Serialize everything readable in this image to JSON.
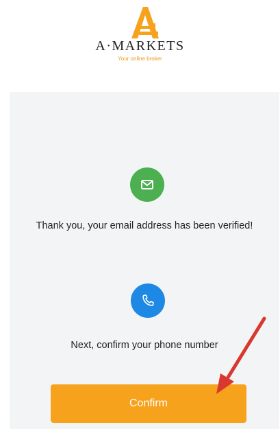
{
  "header": {
    "brand_name": "A·MARKETS",
    "tagline": "Your online broker",
    "logo_icon": "amarkets-logo-icon"
  },
  "verification": {
    "email_icon": "envelope-icon",
    "email_message": "Thank you, your email address has been verified!",
    "phone_icon": "phone-icon",
    "phone_message": "Next, confirm your phone number",
    "confirm_label": "Confirm"
  },
  "annotation": {
    "arrow_icon": "red-arrow-icon"
  },
  "colors": {
    "brand_orange": "#f6a21c",
    "email_green": "#4caf50",
    "phone_blue": "#1e88e5",
    "arrow_red": "#d9382e",
    "card_bg": "#f3f4f6"
  }
}
